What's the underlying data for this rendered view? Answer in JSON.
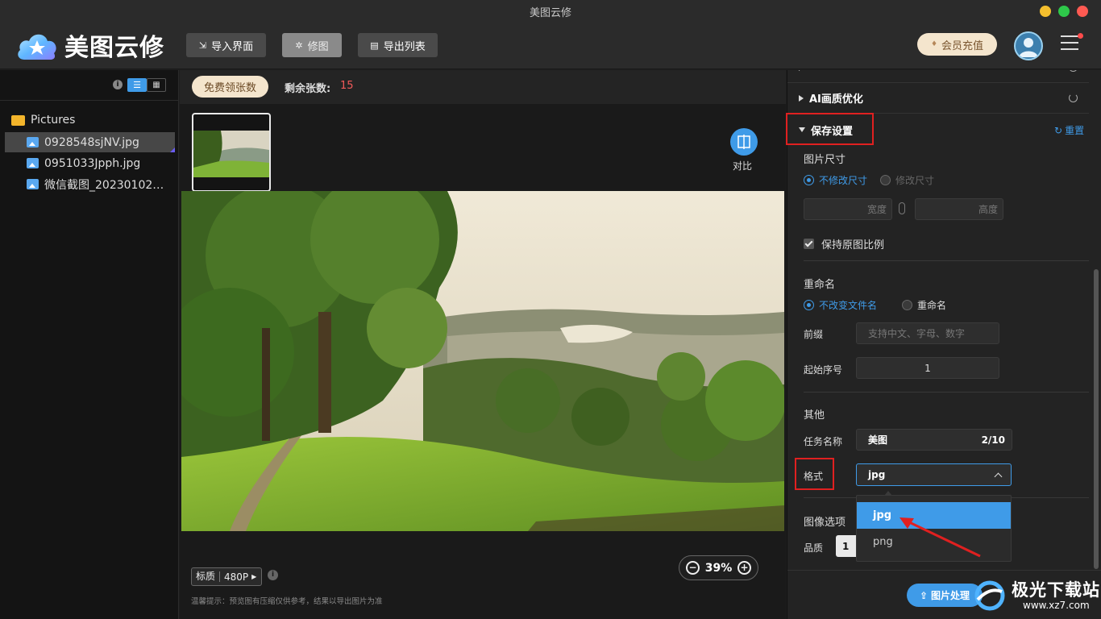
{
  "window": {
    "title": "美图云修"
  },
  "header": {
    "app_name": "美图云修",
    "buttons": [
      {
        "label": "导入界面",
        "icon": "import-icon"
      },
      {
        "label": "修图",
        "icon": "sparkle-icon",
        "active": true
      },
      {
        "label": "导出列表",
        "icon": "list-doc-icon"
      }
    ],
    "vip_label": "会员充值"
  },
  "sidebar": {
    "folder": "Pictures",
    "files": [
      {
        "name": "0928548sjNV.jpg",
        "selected": true
      },
      {
        "name": "0951033Jpph.jpg",
        "selected": false
      },
      {
        "name": "微信截图_20230102…",
        "selected": false
      }
    ]
  },
  "center": {
    "free_btn": "免费领张数",
    "remain_label": "剩余张数:",
    "remain_value": "15",
    "compare_label": "对比",
    "quality_label": "标质",
    "quality_value": "480P",
    "tip": "温馨提示：预览图有压缩仅供参考，结果以导出图片为准",
    "zoom": "39%"
  },
  "right_panel": {
    "sections": [
      {
        "title": "AI画质优化"
      },
      {
        "title": "保存设置"
      }
    ],
    "reset_label": "重置",
    "size": {
      "label": "图片尺寸",
      "opt_keep": "不修改尺寸",
      "opt_change": "修改尺寸",
      "width_placeholder": "宽度",
      "height_placeholder": "高度",
      "keep_ratio": "保持原图比例"
    },
    "rename": {
      "label": "重命名",
      "opt_keep": "不改变文件名",
      "opt_rename": "重命名",
      "prefix_label": "前缀",
      "prefix_placeholder": "支持中文、字母、数字",
      "start_label": "起始序号",
      "start_value": "1"
    },
    "other": {
      "label": "其他",
      "task_label": "任务名称",
      "task_value": "美图",
      "task_count": "2/10",
      "format_label": "格式",
      "format_value": "jpg",
      "format_options": [
        "jpg",
        "png"
      ],
      "image_options_label": "图像选项",
      "quality_label": "品质",
      "quality_value": "1"
    },
    "process_btn": "图片处理"
  },
  "watermark": {
    "title": "极光下载站",
    "url": "www.xz7.com"
  },
  "colors": {
    "accent": "#3f9be8",
    "highlight": "#e02020",
    "vip": "#f4e5cd"
  }
}
